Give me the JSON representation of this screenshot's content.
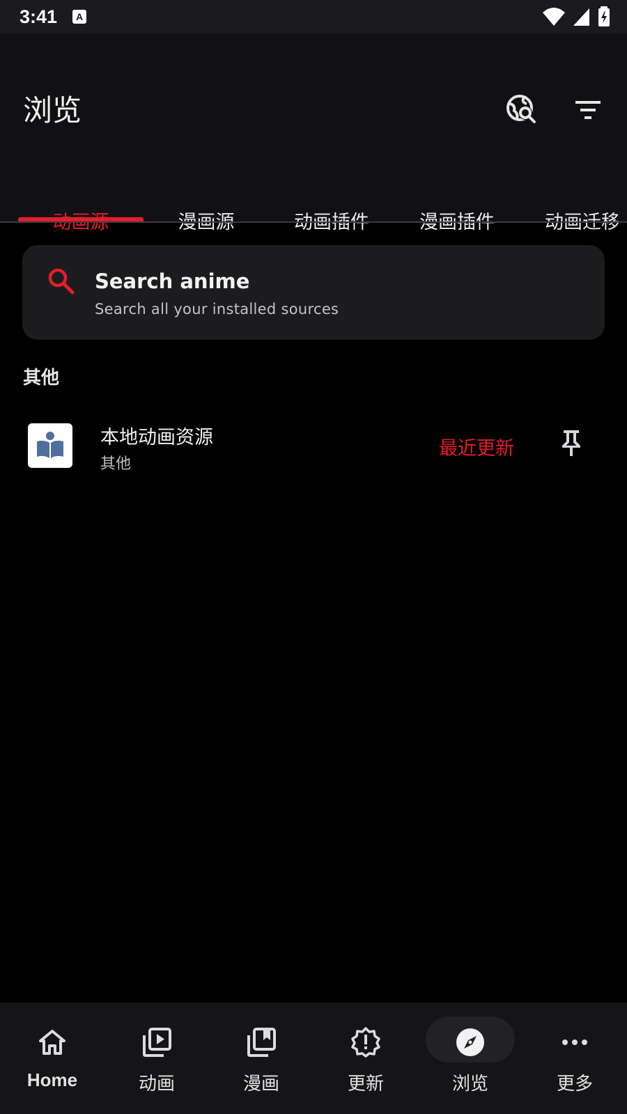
{
  "status_bar": {
    "time": "3:41",
    "notification_icon": "A"
  },
  "header": {
    "title": "浏览"
  },
  "tabs": [
    {
      "label": "动画源",
      "active": true
    },
    {
      "label": "漫画源",
      "active": false
    },
    {
      "label": "动画插件",
      "active": false
    },
    {
      "label": "漫画插件",
      "active": false
    },
    {
      "label": "动画迁移",
      "active": false
    }
  ],
  "search": {
    "title": "Search anime",
    "subtitle": "Search all your installed sources"
  },
  "section": {
    "header": "其他"
  },
  "sources": [
    {
      "name": "本地动画资源",
      "language": "其他",
      "latest_label": "最近更新"
    }
  ],
  "bottom_nav": [
    {
      "label": "Home",
      "icon": "home-icon",
      "active": false
    },
    {
      "label": "动画",
      "icon": "video-library-icon",
      "active": false
    },
    {
      "label": "漫画",
      "icon": "collections-bookmark-icon",
      "active": false
    },
    {
      "label": "更新",
      "icon": "new-releases-icon",
      "active": false
    },
    {
      "label": "浏览",
      "icon": "explore-icon",
      "active": true
    },
    {
      "label": "更多",
      "icon": "more-horiz-icon",
      "active": false
    }
  ],
  "colors": {
    "accent": "#e51d2b",
    "background": "#000000",
    "surface": "#111114"
  }
}
